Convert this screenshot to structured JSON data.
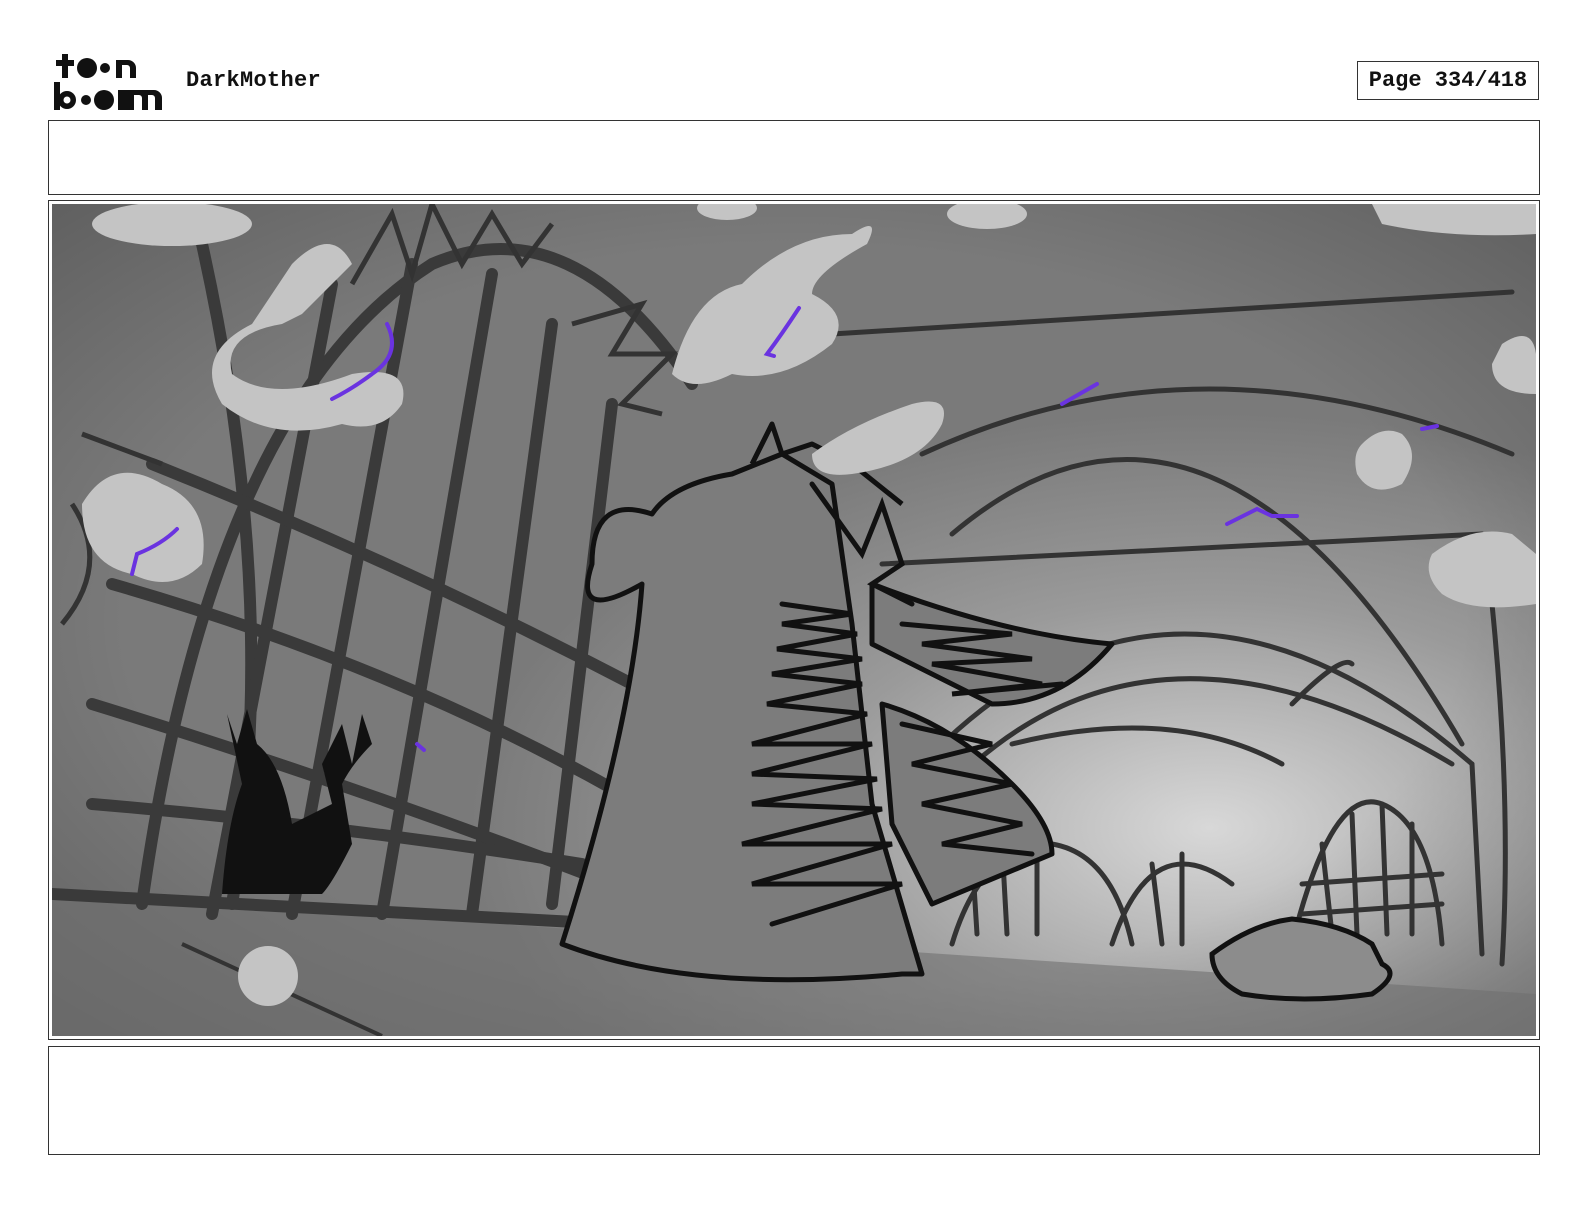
{
  "header": {
    "logo_text": "toon boom",
    "project_title": "DarkMother",
    "page_label": "Page 334/418"
  },
  "panel": {
    "action_notes": "",
    "dialogue_notes": ""
  },
  "colors": {
    "ink": "#111111",
    "sketch_gray": "#7a7a7a",
    "cloud_gray": "#c4c4c4",
    "accent_violet": "#6a33e0"
  }
}
